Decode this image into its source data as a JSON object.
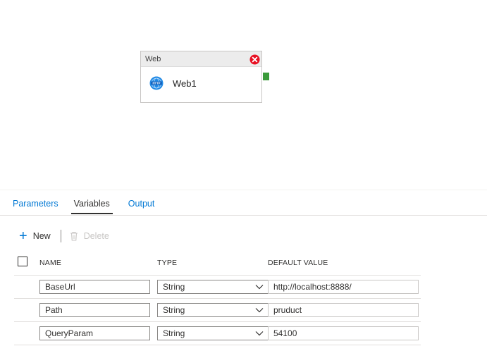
{
  "canvas": {
    "activity": {
      "type_label": "Web",
      "name": "Web1",
      "icon": "http-globe-icon",
      "status_icon": "error-icon",
      "error_color": "#e81123",
      "success_handle_color": "#3a9a3a"
    }
  },
  "tabs": [
    {
      "label": "Parameters",
      "active": false
    },
    {
      "label": "Variables",
      "active": true
    },
    {
      "label": "Output",
      "active": false
    }
  ],
  "toolbar": {
    "new_label": "New",
    "delete_label": "Delete"
  },
  "table": {
    "headers": {
      "name": "NAME",
      "type": "TYPE",
      "default_value": "DEFAULT VALUE"
    },
    "rows": [
      {
        "name": "BaseUrl",
        "type": "String",
        "default_value": "http://localhost:8888/"
      },
      {
        "name": "Path",
        "type": "String",
        "default_value": "pruduct"
      },
      {
        "name": "QueryParam",
        "type": "String",
        "default_value": "54100"
      }
    ]
  },
  "colors": {
    "accent": "#0078d4",
    "text": "#323130",
    "border": "#8a8886"
  }
}
